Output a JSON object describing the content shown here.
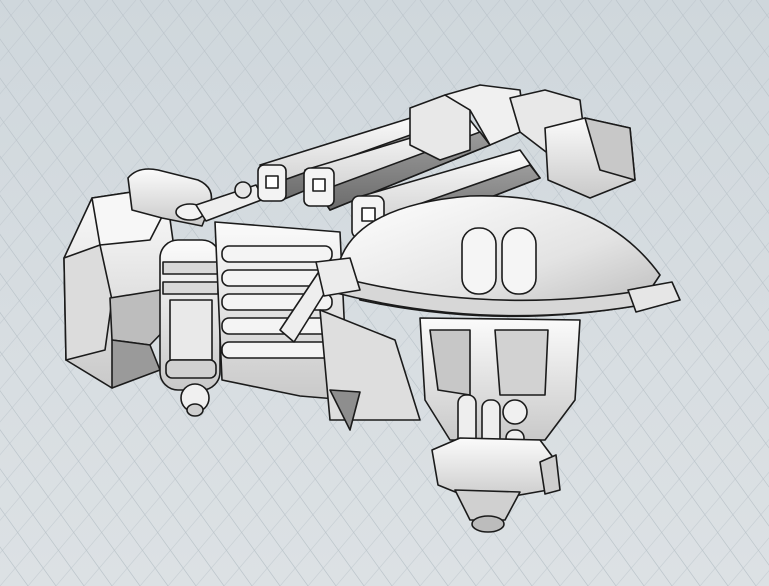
{
  "viewport": {
    "name": "3d-modeling-viewport",
    "background_top": "#cfd7dc",
    "background_bottom": "#dce1e4",
    "grid_color": "#bcc5cb",
    "model_fill_light": "#f4f4f4",
    "model_fill_mid": "#d6d6d6",
    "model_fill_dark": "#8a8a8a",
    "model_outline": "#1a1a1a"
  },
  "scene": {
    "object": "mechanical-turret-model",
    "barrel_count": 4
  }
}
